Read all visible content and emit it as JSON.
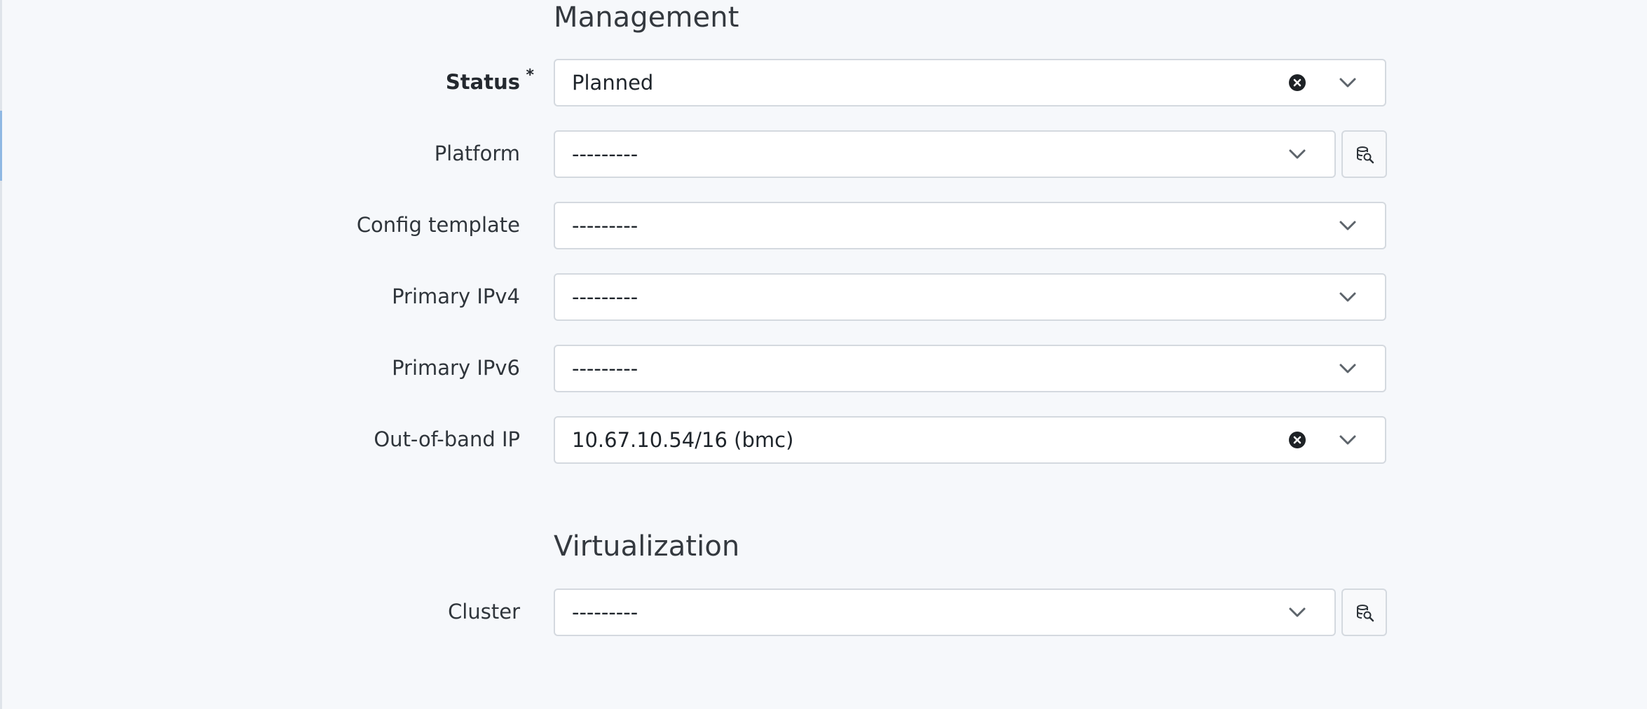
{
  "sections": {
    "management": {
      "title": "Management"
    },
    "virtualization": {
      "title": "Virtualization"
    }
  },
  "fields": {
    "status": {
      "label": "Status",
      "required_marker": "*",
      "value": "Planned"
    },
    "platform": {
      "label": "Platform",
      "value": "---------"
    },
    "config_template": {
      "label": "Config template",
      "value": "---------"
    },
    "primary_ipv4": {
      "label": "Primary IPv4",
      "value": "---------"
    },
    "primary_ipv6": {
      "label": "Primary IPv6",
      "value": "---------"
    },
    "oob_ip": {
      "label": "Out-of-band IP",
      "value": "10.67.10.54/16 (bmc)"
    },
    "cluster": {
      "label": "Cluster",
      "value": "---------"
    }
  },
  "icons": {
    "clear": "clear-circle-x-icon",
    "dropdown": "chevron-down-icon",
    "selector": "database-search-icon"
  }
}
